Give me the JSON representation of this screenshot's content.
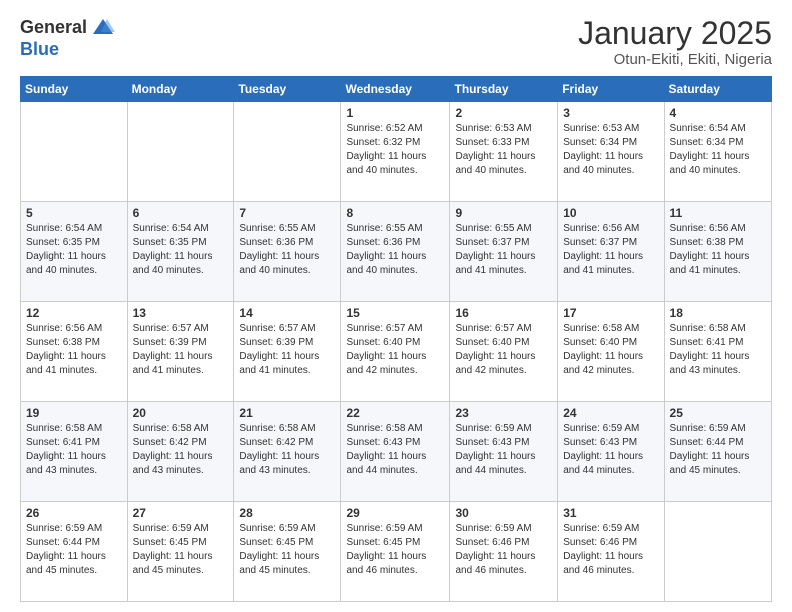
{
  "logo": {
    "general": "General",
    "blue": "Blue"
  },
  "header": {
    "month": "January 2025",
    "location": "Otun-Ekiti, Ekiti, Nigeria"
  },
  "days_of_week": [
    "Sunday",
    "Monday",
    "Tuesday",
    "Wednesday",
    "Thursday",
    "Friday",
    "Saturday"
  ],
  "weeks": [
    [
      {
        "day": "",
        "info": ""
      },
      {
        "day": "",
        "info": ""
      },
      {
        "day": "",
        "info": ""
      },
      {
        "day": "1",
        "info": "Sunrise: 6:52 AM\nSunset: 6:32 PM\nDaylight: 11 hours and 40 minutes."
      },
      {
        "day": "2",
        "info": "Sunrise: 6:53 AM\nSunset: 6:33 PM\nDaylight: 11 hours and 40 minutes."
      },
      {
        "day": "3",
        "info": "Sunrise: 6:53 AM\nSunset: 6:34 PM\nDaylight: 11 hours and 40 minutes."
      },
      {
        "day": "4",
        "info": "Sunrise: 6:54 AM\nSunset: 6:34 PM\nDaylight: 11 hours and 40 minutes."
      }
    ],
    [
      {
        "day": "5",
        "info": "Sunrise: 6:54 AM\nSunset: 6:35 PM\nDaylight: 11 hours and 40 minutes."
      },
      {
        "day": "6",
        "info": "Sunrise: 6:54 AM\nSunset: 6:35 PM\nDaylight: 11 hours and 40 minutes."
      },
      {
        "day": "7",
        "info": "Sunrise: 6:55 AM\nSunset: 6:36 PM\nDaylight: 11 hours and 40 minutes."
      },
      {
        "day": "8",
        "info": "Sunrise: 6:55 AM\nSunset: 6:36 PM\nDaylight: 11 hours and 40 minutes."
      },
      {
        "day": "9",
        "info": "Sunrise: 6:55 AM\nSunset: 6:37 PM\nDaylight: 11 hours and 41 minutes."
      },
      {
        "day": "10",
        "info": "Sunrise: 6:56 AM\nSunset: 6:37 PM\nDaylight: 11 hours and 41 minutes."
      },
      {
        "day": "11",
        "info": "Sunrise: 6:56 AM\nSunset: 6:38 PM\nDaylight: 11 hours and 41 minutes."
      }
    ],
    [
      {
        "day": "12",
        "info": "Sunrise: 6:56 AM\nSunset: 6:38 PM\nDaylight: 11 hours and 41 minutes."
      },
      {
        "day": "13",
        "info": "Sunrise: 6:57 AM\nSunset: 6:39 PM\nDaylight: 11 hours and 41 minutes."
      },
      {
        "day": "14",
        "info": "Sunrise: 6:57 AM\nSunset: 6:39 PM\nDaylight: 11 hours and 41 minutes."
      },
      {
        "day": "15",
        "info": "Sunrise: 6:57 AM\nSunset: 6:40 PM\nDaylight: 11 hours and 42 minutes."
      },
      {
        "day": "16",
        "info": "Sunrise: 6:57 AM\nSunset: 6:40 PM\nDaylight: 11 hours and 42 minutes."
      },
      {
        "day": "17",
        "info": "Sunrise: 6:58 AM\nSunset: 6:40 PM\nDaylight: 11 hours and 42 minutes."
      },
      {
        "day": "18",
        "info": "Sunrise: 6:58 AM\nSunset: 6:41 PM\nDaylight: 11 hours and 43 minutes."
      }
    ],
    [
      {
        "day": "19",
        "info": "Sunrise: 6:58 AM\nSunset: 6:41 PM\nDaylight: 11 hours and 43 minutes."
      },
      {
        "day": "20",
        "info": "Sunrise: 6:58 AM\nSunset: 6:42 PM\nDaylight: 11 hours and 43 minutes."
      },
      {
        "day": "21",
        "info": "Sunrise: 6:58 AM\nSunset: 6:42 PM\nDaylight: 11 hours and 43 minutes."
      },
      {
        "day": "22",
        "info": "Sunrise: 6:58 AM\nSunset: 6:43 PM\nDaylight: 11 hours and 44 minutes."
      },
      {
        "day": "23",
        "info": "Sunrise: 6:59 AM\nSunset: 6:43 PM\nDaylight: 11 hours and 44 minutes."
      },
      {
        "day": "24",
        "info": "Sunrise: 6:59 AM\nSunset: 6:43 PM\nDaylight: 11 hours and 44 minutes."
      },
      {
        "day": "25",
        "info": "Sunrise: 6:59 AM\nSunset: 6:44 PM\nDaylight: 11 hours and 45 minutes."
      }
    ],
    [
      {
        "day": "26",
        "info": "Sunrise: 6:59 AM\nSunset: 6:44 PM\nDaylight: 11 hours and 45 minutes."
      },
      {
        "day": "27",
        "info": "Sunrise: 6:59 AM\nSunset: 6:45 PM\nDaylight: 11 hours and 45 minutes."
      },
      {
        "day": "28",
        "info": "Sunrise: 6:59 AM\nSunset: 6:45 PM\nDaylight: 11 hours and 45 minutes."
      },
      {
        "day": "29",
        "info": "Sunrise: 6:59 AM\nSunset: 6:45 PM\nDaylight: 11 hours and 46 minutes."
      },
      {
        "day": "30",
        "info": "Sunrise: 6:59 AM\nSunset: 6:46 PM\nDaylight: 11 hours and 46 minutes."
      },
      {
        "day": "31",
        "info": "Sunrise: 6:59 AM\nSunset: 6:46 PM\nDaylight: 11 hours and 46 minutes."
      },
      {
        "day": "",
        "info": ""
      }
    ]
  ]
}
